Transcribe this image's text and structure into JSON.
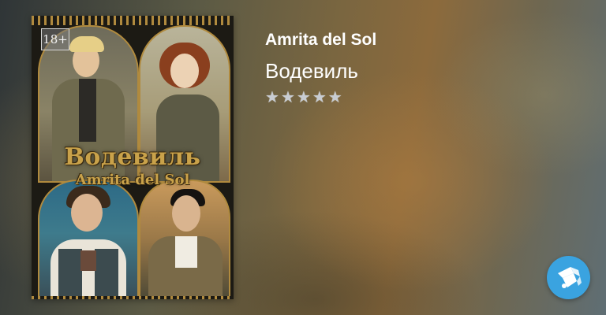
{
  "book": {
    "author": "Amrita del Sol",
    "title": "Водевиль",
    "rating_stars": 5,
    "rating_filled": 0
  },
  "cover": {
    "age_rating": "18+",
    "title": "Водевиль",
    "author": "Amrita del Sol"
  },
  "colors": {
    "brand": "#3aa3e0",
    "star": "#c8ccd2",
    "cover_text": "#c9a24a"
  },
  "icons": {
    "star": "star-icon",
    "logo": "litres-logo-icon"
  }
}
